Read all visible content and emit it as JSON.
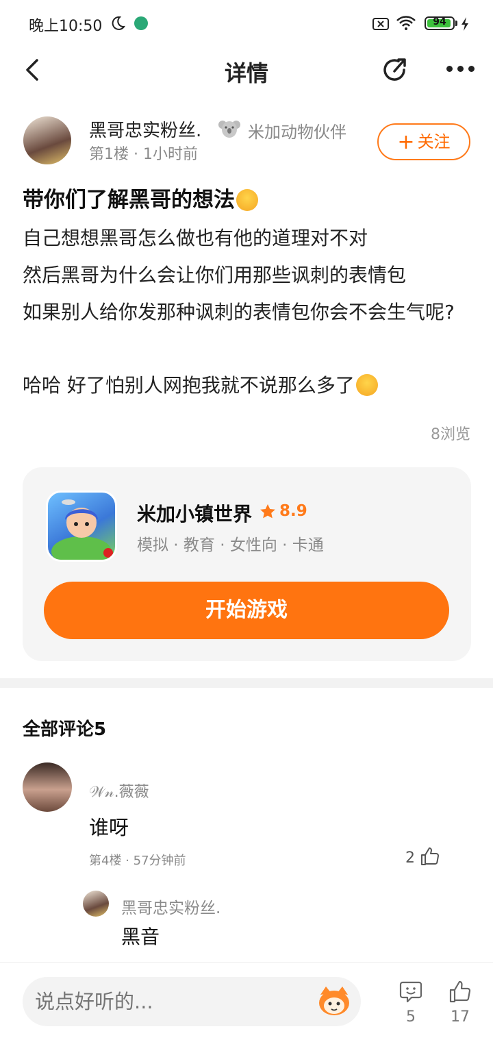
{
  "status_bar": {
    "time": "晚上10:50",
    "battery": "94",
    "battery_level": 0.94
  },
  "header": {
    "title": "详情"
  },
  "post": {
    "author": "黑哥忠实粉丝.",
    "badge": "米加动物伙伴",
    "meta": "第1楼 · 1小时前",
    "follow_label": "关注",
    "title": "带你们了解黑哥的想法",
    "lines": [
      "自己想想黑哥怎么做也有他的道理对不对",
      "然后黑哥为什么会让你们用那些讽刺的表情包",
      "如果别人给你发那种讽刺的表情包你会不会生气呢?",
      "哈哈 好了怕别人网抱我就不说那么多了"
    ],
    "views": "8浏览"
  },
  "game": {
    "name": "米加小镇世界",
    "rating": "8.9",
    "tags": "模拟 · 教育 · 女性向 · 卡通",
    "play_label": "开始游戏"
  },
  "comments": {
    "title": "全部评论5",
    "items": [
      {
        "user": "𝒲𝓃.薇薇",
        "text": "谁呀",
        "meta": "第4楼 · 57分钟前",
        "likes": "2",
        "reply": {
          "user": "黑哥忠实粉丝.",
          "text": "黑音"
        }
      }
    ]
  },
  "bottom_bar": {
    "input_placeholder": "说点好听的...",
    "comment_count": "5",
    "like_count": "17"
  },
  "colors": {
    "accent": "#ff7410",
    "rating": "#ff7a1a",
    "muted": "#8a8a8a"
  }
}
